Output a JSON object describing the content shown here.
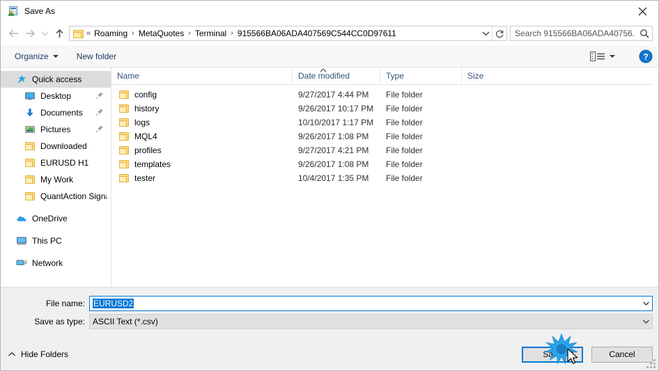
{
  "window": {
    "title": "Save As",
    "title_icon": "save-as-icon",
    "close_label": "✕"
  },
  "nav": {
    "back_icon": "arrow-left-icon",
    "forward_icon": "arrow-right-icon",
    "recent_icon": "chevron-down-icon",
    "up_icon": "arrow-up-icon",
    "folder_icon": "folder-icon",
    "overflow": "«",
    "breadcrumbs": [
      "Roaming",
      "MetaQuotes",
      "Terminal",
      "915566BA06ADA407569C544CC0D97611"
    ],
    "separator": "›",
    "dropdown_icon": "chevron-down-icon",
    "refresh_icon": "refresh-icon"
  },
  "search": {
    "placeholder": "Search 915566BA06ADA40756...",
    "value": "",
    "icon": "search-icon"
  },
  "toolbar": {
    "organize_label": "Organize",
    "new_folder_label": "New folder",
    "view_icon": "view-list-icon",
    "view_caret_icon": "chevron-down-icon",
    "help_icon": "help-icon",
    "help_label": "?"
  },
  "sidebar": {
    "items": [
      {
        "label": "Quick access",
        "icon": "star-pin-icon",
        "selected": true,
        "indent": false,
        "pinned": false
      },
      {
        "label": "Desktop",
        "icon": "monitor-icon",
        "selected": false,
        "indent": true,
        "pinned": true
      },
      {
        "label": "Documents",
        "icon": "download-arrow-icon",
        "selected": false,
        "indent": true,
        "pinned": true
      },
      {
        "label": "Pictures",
        "icon": "pictures-icon",
        "selected": false,
        "indent": true,
        "pinned": true
      },
      {
        "label": "Downloaded",
        "icon": "folder-icon",
        "selected": false,
        "indent": true,
        "pinned": false
      },
      {
        "label": "EURUSD H1",
        "icon": "folder-icon",
        "selected": false,
        "indent": true,
        "pinned": false
      },
      {
        "label": "My Work",
        "icon": "folder-icon",
        "selected": false,
        "indent": true,
        "pinned": false
      },
      {
        "label": "QuantAction Signal",
        "icon": "folder-icon",
        "selected": false,
        "indent": true,
        "pinned": false
      },
      {
        "label": "OneDrive",
        "icon": "cloud-icon",
        "selected": false,
        "indent": false,
        "pinned": false,
        "gap_before": true
      },
      {
        "label": "This PC",
        "icon": "computer-icon",
        "selected": false,
        "indent": false,
        "pinned": false,
        "gap_before": true
      },
      {
        "label": "Network",
        "icon": "network-icon",
        "selected": false,
        "indent": false,
        "pinned": false,
        "gap_before": true
      }
    ]
  },
  "filelist": {
    "columns": [
      "Name",
      "Date modified",
      "Type",
      "Size"
    ],
    "sort_column": "Name",
    "sort_direction": "ascending",
    "rows": [
      {
        "name": "config",
        "date": "9/27/2017 4:44 PM",
        "type": "File folder",
        "size": "",
        "icon": "folder-icon"
      },
      {
        "name": "history",
        "date": "9/26/2017 10:17 PM",
        "type": "File folder",
        "size": "",
        "icon": "folder-icon"
      },
      {
        "name": "logs",
        "date": "10/10/2017 1:17 PM",
        "type": "File folder",
        "size": "",
        "icon": "folder-icon"
      },
      {
        "name": "MQL4",
        "date": "9/26/2017 1:08 PM",
        "type": "File folder",
        "size": "",
        "icon": "folder-icon"
      },
      {
        "name": "profiles",
        "date": "9/27/2017 4:21 PM",
        "type": "File folder",
        "size": "",
        "icon": "folder-icon"
      },
      {
        "name": "templates",
        "date": "9/26/2017 1:08 PM",
        "type": "File folder",
        "size": "",
        "icon": "folder-icon"
      },
      {
        "name": "tester",
        "date": "10/4/2017 1:35 PM",
        "type": "File folder",
        "size": "",
        "icon": "folder-icon"
      }
    ]
  },
  "form": {
    "filename_label": "File name:",
    "filename_value": "EURUSD2",
    "filename_selected": true,
    "filetype_label": "Save as type:",
    "filetype_value": "ASCII Text (*.csv)",
    "dropdown_icon": "chevron-down-icon"
  },
  "footer": {
    "hide_folders_label": "Hide Folders",
    "hide_folders_icon": "chevron-up-icon",
    "save_label": "Save",
    "cancel_label": "Cancel",
    "resize_grip_icon": "resize-grip-icon"
  },
  "colors": {
    "accent": "#0078d7",
    "selection": "#0078d7",
    "sidebar_selected": "#dcdcdc",
    "header_text": "#32527a",
    "toolbar_text": "#1f3a63",
    "folder_yellow": "#fdd97c",
    "burst": "#1e9ae0"
  },
  "overlay": {
    "click_burst_icon": "click-burst-icon",
    "cursor_icon": "mouse-cursor-icon"
  }
}
